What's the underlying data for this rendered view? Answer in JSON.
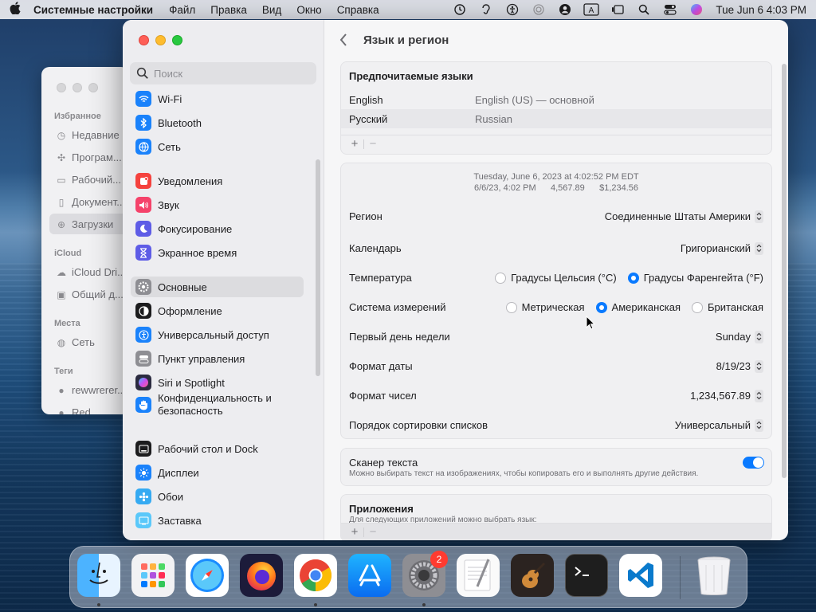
{
  "menubar": {
    "app": "Системные настройки",
    "items": [
      "Файл",
      "Правка",
      "Вид",
      "Окно",
      "Справка"
    ],
    "datetime": "Tue Jun 6  4:03 PM"
  },
  "finder": {
    "favorites": "Избранное",
    "items": [
      "Недавние",
      "Програм...",
      "Рабочий...",
      "Документ...",
      "Загрузки"
    ],
    "icloud": "iCloud",
    "icloud_items": [
      "iCloud Dri...",
      "Общий д..."
    ],
    "places": "Места",
    "places_items": [
      "Сеть"
    ],
    "tags": "Теги",
    "tag_items": [
      "rewwrerer...",
      "Red"
    ]
  },
  "sidebar": {
    "search_placeholder": "Поиск",
    "items": [
      {
        "label": "Wi-Fi",
        "icon": "wifi-icon",
        "color": "#1a82fb"
      },
      {
        "label": "Bluetooth",
        "icon": "bluetooth-icon",
        "color": "#1a82fb"
      },
      {
        "label": "Сеть",
        "icon": "globe-icon",
        "color": "#1a82fb"
      },
      {
        "label": "Уведомления",
        "icon": "bell-icon",
        "color": "#f5423e"
      },
      {
        "label": "Звук",
        "icon": "speaker-icon",
        "color": "#f5426a"
      },
      {
        "label": "Фокусирование",
        "icon": "moon-icon",
        "color": "#5e5ce6"
      },
      {
        "label": "Экранное время",
        "icon": "hourglass-icon",
        "color": "#5e5ce6"
      },
      {
        "label": "Основные",
        "icon": "gear-icon",
        "color": "#8e8e93"
      },
      {
        "label": "Оформление",
        "icon": "appearance-icon",
        "color": "#1c1c1e"
      },
      {
        "label": "Универсальный доступ",
        "icon": "accessibility-icon",
        "color": "#1a82fb"
      },
      {
        "label": "Пункт управления",
        "icon": "control-center-icon",
        "color": "#8e8e93"
      },
      {
        "label": "Siri и Spotlight",
        "icon": "siri-icon",
        "color": "#2b2b40"
      },
      {
        "label": "Конфиденциальность и безопасность",
        "icon": "hand-icon",
        "color": "#1a82fb"
      },
      {
        "label": "Рабочий стол и Dock",
        "icon": "dock-icon",
        "color": "#1c1c1e"
      },
      {
        "label": "Дисплеи",
        "icon": "brightness-icon",
        "color": "#1a82fb"
      },
      {
        "label": "Обои",
        "icon": "wallpaper-icon",
        "color": "#35aaf2"
      },
      {
        "label": "Заставка",
        "icon": "screensaver-icon",
        "color": "#5ac8fa"
      }
    ]
  },
  "content": {
    "title": "Язык и регион",
    "preferred_languages": {
      "header": "Предпочитаемые языки",
      "rows": [
        {
          "name": "English",
          "value": "English (US) — основной"
        },
        {
          "name": "Русский",
          "value": "Russian"
        }
      ]
    },
    "format_preview": {
      "line1": "Tuesday, June 6, 2023 at 4:02:52 PM EDT",
      "line2": "6/6/23, 4:02 PM      4,567.89      $1,234.56"
    },
    "region": {
      "label": "Регион",
      "value": "Соединенные Штаты Америки"
    },
    "calendar": {
      "label": "Календарь",
      "value": "Григорианский"
    },
    "temperature": {
      "label": "Температура",
      "option1": "Градусы Цельсия (°C)",
      "option2": "Градусы Фаренгейта (°F)"
    },
    "measurement": {
      "label": "Система измерений",
      "option1": "Метрическая",
      "option2": "Американская",
      "option3": "Британская"
    },
    "first_day": {
      "label": "Первый день недели",
      "value": "Sunday"
    },
    "date_format": {
      "label": "Формат даты",
      "value": "8/19/23"
    },
    "number_format": {
      "label": "Формат чисел",
      "value": "1,234,567.89"
    },
    "sort_order": {
      "label": "Порядок сортировки списков",
      "value": "Универсальный"
    },
    "live_text": {
      "label": "Сканер текста",
      "desc": "Можно выбирать текст на изображениях, чтобы копировать его и выполнять другие действия."
    },
    "apps": {
      "header": "Приложения",
      "desc": "Для следующих приложений можно выбрать язык:"
    }
  },
  "dock": {
    "apps": [
      "Finder",
      "Launchpad",
      "Safari",
      "Firefox",
      "Chrome",
      "App Store",
      "Системные настройки",
      "TextEdit",
      "GarageBand",
      "Terminal",
      "Visual Studio Code",
      "Корзина"
    ],
    "settings_badge": "2"
  }
}
